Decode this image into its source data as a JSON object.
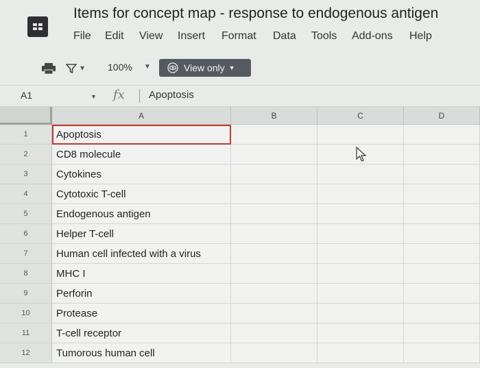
{
  "app": {
    "doc_title": "Items for concept map - response to endogenous antigen",
    "icon": "sheets-grid-icon"
  },
  "menu": [
    "File",
    "Edit",
    "View",
    "Insert",
    "Format",
    "Data",
    "Tools",
    "Add-ons",
    "Help"
  ],
  "toolbar": {
    "zoom": "100%",
    "view_only_label": "View only"
  },
  "formula_bar": {
    "name_box": "A1",
    "fx": "fx",
    "value": "Apoptosis"
  },
  "sheet": {
    "columns": [
      "A",
      "B",
      "C",
      "D"
    ],
    "rows": [
      {
        "num": "1",
        "a": "Apoptosis"
      },
      {
        "num": "2",
        "a": "CD8 molecule"
      },
      {
        "num": "3",
        "a": "Cytokines"
      },
      {
        "num": "4",
        "a": "Cytotoxic T-cell"
      },
      {
        "num": "5",
        "a": "Endogenous antigen"
      },
      {
        "num": "6",
        "a": "Helper T-cell"
      },
      {
        "num": "7",
        "a": "Human cell infected with a virus"
      },
      {
        "num": "8",
        "a": "MHC I"
      },
      {
        "num": "9",
        "a": "Perforin"
      },
      {
        "num": "10",
        "a": "Protease"
      },
      {
        "num": "11",
        "a": "T-cell receptor"
      },
      {
        "num": "12",
        "a": "Tumorous human cell"
      }
    ],
    "selected_cell": "A1"
  }
}
